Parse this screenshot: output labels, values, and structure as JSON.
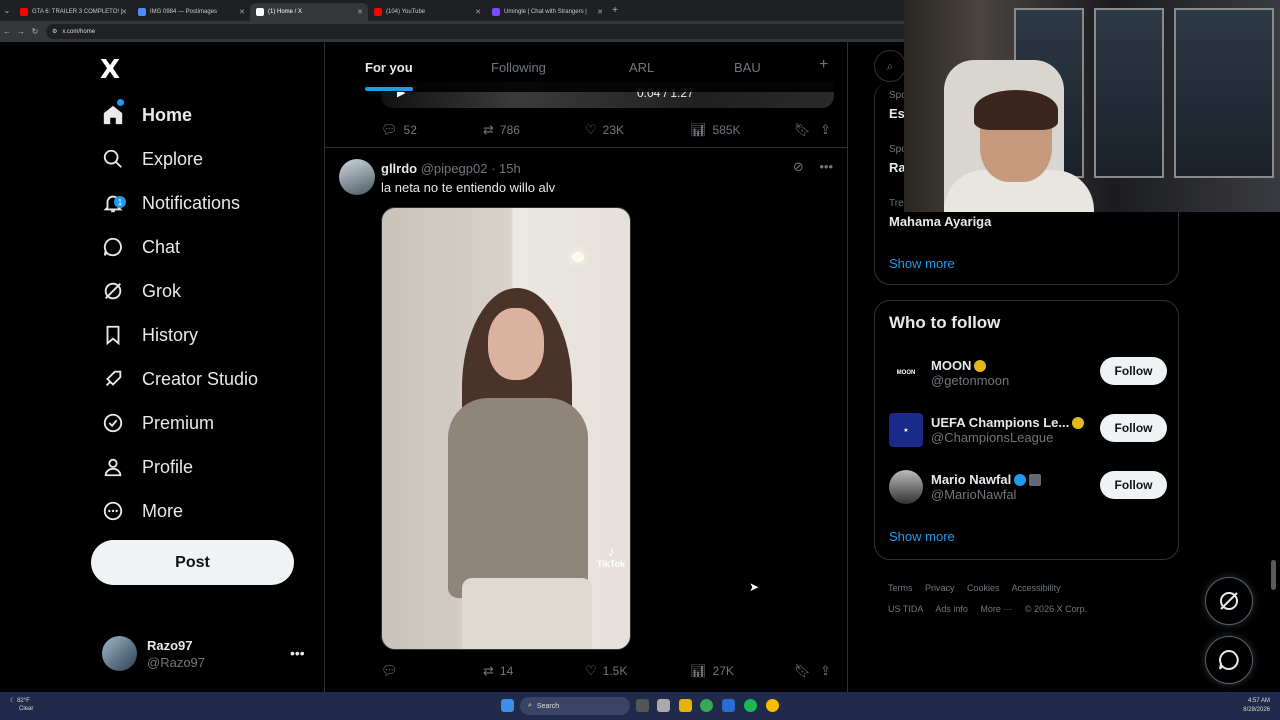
{
  "browser": {
    "tabs": [
      {
        "label": "GTA 6: TRAILER 3 COMPLETO! |",
        "color": "#ff0000"
      },
      {
        "label": "IMG 0984 — Postimages",
        "color": "#4b8cff"
      },
      {
        "label": "(1) Home / X",
        "color": "#ffffff",
        "active": true
      },
      {
        "label": "(104) YouTube",
        "color": "#ff0000"
      },
      {
        "label": "Umingle | Chat with Strangers |",
        "color": "#7b4bff"
      }
    ],
    "url": "x.com/home"
  },
  "sidebar": {
    "logo": "X",
    "items": [
      {
        "label": "Home",
        "icon": "home-icon"
      },
      {
        "label": "Explore",
        "icon": "search-icon"
      },
      {
        "label": "Notifications",
        "icon": "bell-icon",
        "badge": "1"
      },
      {
        "label": "Chat",
        "icon": "chat-icon"
      },
      {
        "label": "Grok",
        "icon": "grok-icon"
      },
      {
        "label": "History",
        "icon": "bookmark-icon"
      },
      {
        "label": "Creator Studio",
        "icon": "rocket-icon"
      },
      {
        "label": "Premium",
        "icon": "verified-icon"
      },
      {
        "label": "Profile",
        "icon": "person-icon"
      },
      {
        "label": "More",
        "icon": "more-circle-icon"
      }
    ],
    "post_label": "Post",
    "user": {
      "name": "Razo97",
      "handle": "@Razo97"
    }
  },
  "feed": {
    "tabs": [
      "For you",
      "Following",
      "ARL",
      "BAU"
    ],
    "video_time": "0:04 / 1:27",
    "prev_actions": {
      "replies": "52",
      "reposts": "786",
      "likes": "23K",
      "views": "585K"
    },
    "tweet": {
      "name": "gllrdo",
      "handle": "@pipegp02",
      "time": "· 15h",
      "text": "la neta no te entiendo willo alv",
      "media_watermark": "TikTok",
      "actions": {
        "replies": "",
        "reposts": "14",
        "likes": "1.5K",
        "views": "27K"
      }
    }
  },
  "right": {
    "trends": [
      {
        "label": "Spo",
        "name": "Est"
      },
      {
        "label": "Spo",
        "name": "Ra"
      },
      {
        "label": "Tre",
        "name": "Mahama Ayariga"
      }
    ],
    "show_more": "Show more",
    "who_to_follow": {
      "title": "Who to follow",
      "accounts": [
        {
          "name": "MOON",
          "handle": "@getonmoon",
          "badge_color": "#e2b719",
          "follow": "Follow"
        },
        {
          "name": "UEFA Champions Le...",
          "handle": "@ChampionsLeague",
          "badge_color": "#e2b719",
          "follow": "Follow"
        },
        {
          "name": "Mario Nawfal",
          "handle": "@MarioNawfal",
          "badge_color": "#1d9bf0",
          "follow": "Follow"
        }
      ],
      "show_more": "Show more"
    },
    "footer": [
      "Terms",
      "Privacy",
      "Cookies",
      "Accessibility",
      "US TIDA",
      "Ads info",
      "More ···",
      "© 2026 X Corp."
    ]
  },
  "taskbar": {
    "weather_temp": "82°F",
    "weather_desc": "Clear",
    "search": "Search",
    "time": "4:57 AM",
    "date": "8/28/2026"
  },
  "colors": {
    "accent": "#1d9bf0",
    "bg": "#000000",
    "border": "#2f3336",
    "muted": "#71767b"
  }
}
